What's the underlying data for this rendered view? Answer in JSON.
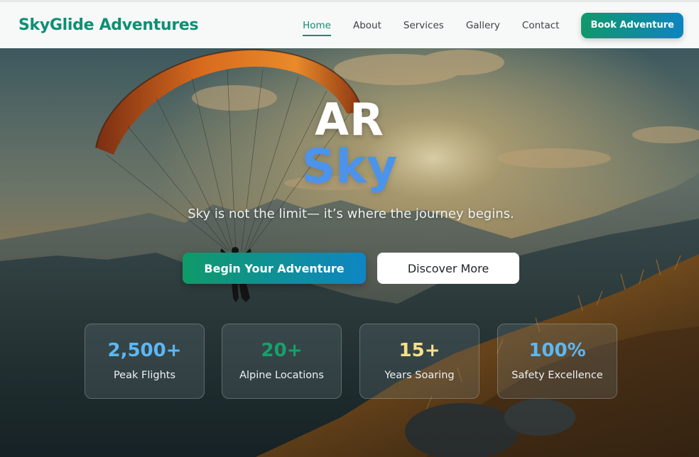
{
  "nav": {
    "brand": "SkyGlide Adventures",
    "items": [
      {
        "label": "Home",
        "active": true
      },
      {
        "label": "About",
        "active": false
      },
      {
        "label": "Services",
        "active": false
      },
      {
        "label": "Gallery",
        "active": false
      },
      {
        "label": "Contact",
        "active": false
      }
    ],
    "cta": "Book Adventure"
  },
  "hero": {
    "title_line1": "AR",
    "title_line2": "Sky",
    "tagline": "Sky is not the limit— it’s where the journey begins.",
    "primary_button": "Begin Your Adventure",
    "secondary_button": "Discover More"
  },
  "stats": [
    {
      "value": "2,500+",
      "label": "Peak Flights",
      "color": "#5bb8f5"
    },
    {
      "value": "20+",
      "label": "Alpine Locations",
      "color": "#17a06c"
    },
    {
      "value": "15+",
      "label": "Years Soaring",
      "color": "#f7e08a"
    },
    {
      "value": "100%",
      "label": "Safety Excellence",
      "color": "#5bb8f5"
    }
  ],
  "colors": {
    "brand": "#0e8f73",
    "accent_blue": "#4c93ec",
    "button_gradient_start": "#0f9a68",
    "button_gradient_end": "#0e86c4"
  }
}
